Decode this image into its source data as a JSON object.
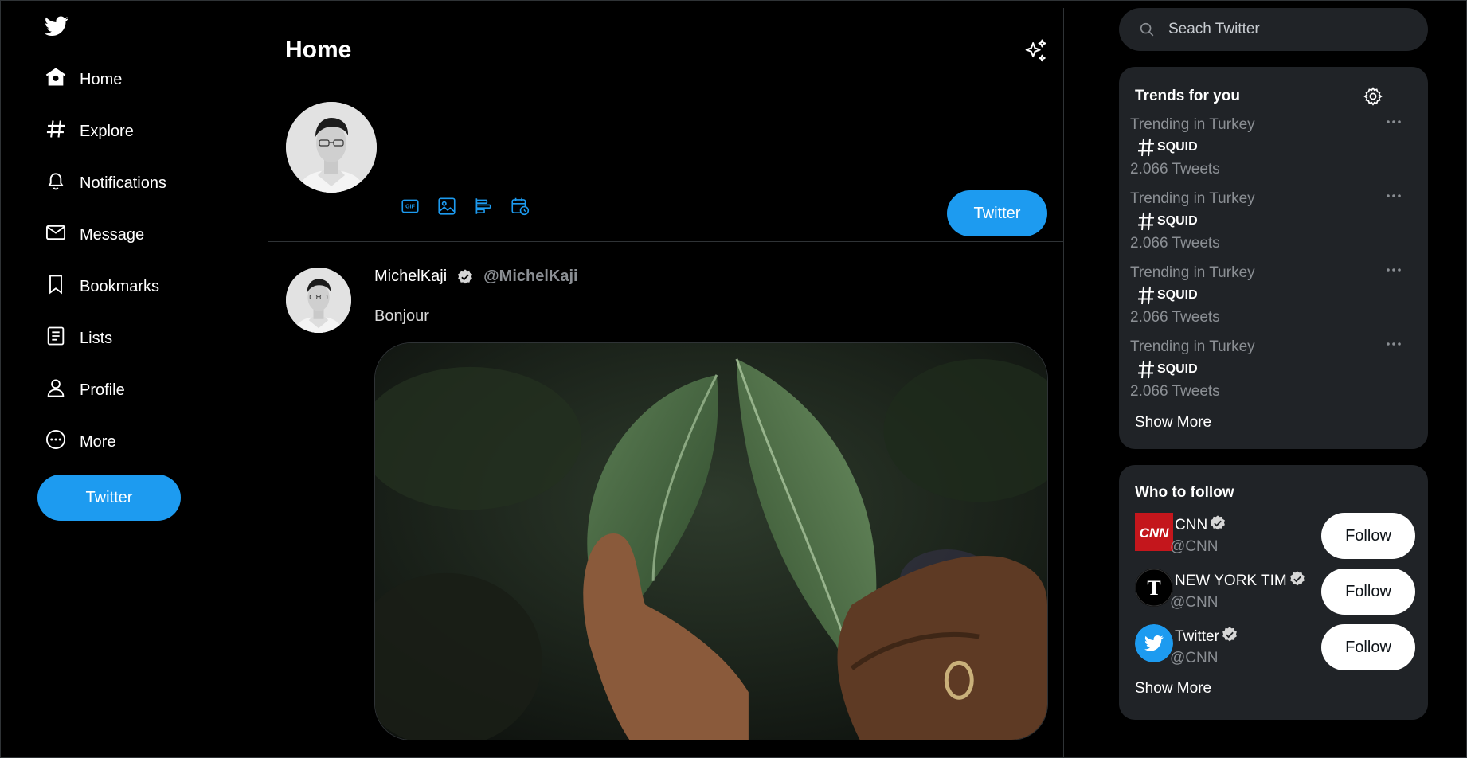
{
  "sidebar": {
    "logo": "twitter-bird-icon",
    "items": [
      {
        "label": "Home",
        "icon": "home-icon"
      },
      {
        "label": "Explore",
        "icon": "hashtag-icon"
      },
      {
        "label": "Notifications",
        "icon": "bell-icon"
      },
      {
        "label": "Message",
        "icon": "envelope-icon"
      },
      {
        "label": "Bookmarks",
        "icon": "bookmark-icon"
      },
      {
        "label": "Lists",
        "icon": "list-icon"
      },
      {
        "label": "Profile",
        "icon": "person-icon"
      },
      {
        "label": "More",
        "icon": "more-circle-icon"
      }
    ],
    "tweet_button": "Twitter"
  },
  "header": {
    "title": "Home",
    "icon": "sparkle-icon"
  },
  "composer": {
    "tools": [
      "gif-icon",
      "image-icon",
      "poll-icon",
      "schedule-icon"
    ],
    "submit_label": "Twitter"
  },
  "tweet": {
    "name": "MichelKaji",
    "handle": "@MichelKaji",
    "text": "Bonjour",
    "media": "photo of hands holding green pepper plant leaves"
  },
  "search": {
    "placeholder": "Seach Twitter"
  },
  "trends": {
    "title": "Trends for you",
    "items": [
      {
        "context": "Trending in Turkey",
        "name": "SQUID",
        "count": "2.066 Tweets"
      },
      {
        "context": "Trending in Turkey",
        "name": "SQUID",
        "count": "2.066 Tweets"
      },
      {
        "context": "Trending in Turkey",
        "name": "SQUID",
        "count": "2.066 Tweets"
      },
      {
        "context": "Trending in Turkey",
        "name": "SQUID",
        "count": "2.066 Tweets"
      }
    ],
    "show_more": "Show More"
  },
  "who_to_follow": {
    "title": "Who to follow",
    "items": [
      {
        "name": "CNN",
        "handle": "@CNN",
        "button": "Follow"
      },
      {
        "name": "NEW YORK TIM",
        "handle": "@CNN",
        "button": "Follow"
      },
      {
        "name": "Twitter",
        "handle": "@CNN",
        "button": "Follow"
      }
    ],
    "show_more": "Show More"
  },
  "colors": {
    "accent": "#1d9bf0",
    "background": "#000000",
    "card": "#202327",
    "muted": "#8b8f94"
  }
}
